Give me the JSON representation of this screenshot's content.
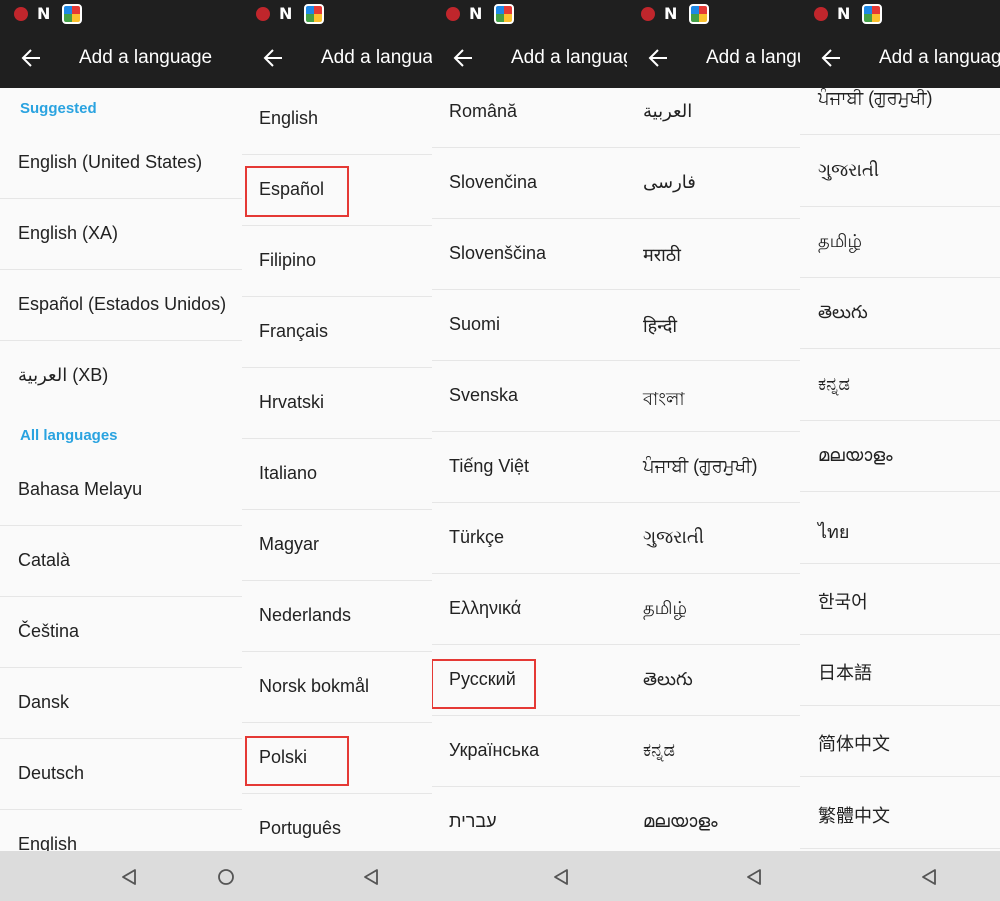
{
  "appbar_title": "Add a language",
  "colors": {
    "header_bg": "#1f1f1f",
    "accent": "#2aa3e0",
    "highlight": "#e53935"
  },
  "status_icons": [
    "notification-red-icon",
    "n-icon",
    "app-icon"
  ],
  "panel1": {
    "suggested_header": "Suggested",
    "all_header": "All languages",
    "suggested": [
      "English (United States)",
      "English (XA)",
      "Español (Estados Unidos)",
      "العربية (XB)"
    ],
    "all": [
      "Bahasa Melayu",
      "Català",
      "Čeština",
      "Dansk",
      "Deutsch",
      "English"
    ]
  },
  "panel2": {
    "items": [
      "English",
      "Español",
      "Filipino",
      "Français",
      "Hrvatski",
      "Italiano",
      "Magyar",
      "Nederlands",
      "Norsk bokmål",
      "Polski",
      "Português"
    ]
  },
  "panel3": {
    "items": [
      "Română",
      "Slovenčina",
      "Slovenščina",
      "Suomi",
      "Svenska",
      "Tiếng Việt",
      "Türkçe",
      "Ελληνικά",
      "Русский",
      "Українська",
      "עברית"
    ]
  },
  "panel4": {
    "items": [
      "العربية",
      "فارسی",
      "मराठी",
      "हिन्दी",
      "বাংলা",
      "ਪੰਜਾਬੀ (ਗੁਰਮੁਖੀ)",
      "ગુજરાતી",
      "தமிழ்",
      "తెలుగు",
      "ಕನ್ನಡ",
      "മലയാളം"
    ]
  },
  "panel5": {
    "items": [
      "ਪੰਜਾਬੀ (ਗੁਰਮੁਖੀ)",
      "ગુજરાતી",
      "தமிழ்",
      "తెలుగు",
      "ಕನ್ನಡ",
      "മലയാളം",
      "ไทย",
      "한국어",
      "日本語",
      "简体中文",
      "繁體中文"
    ]
  }
}
